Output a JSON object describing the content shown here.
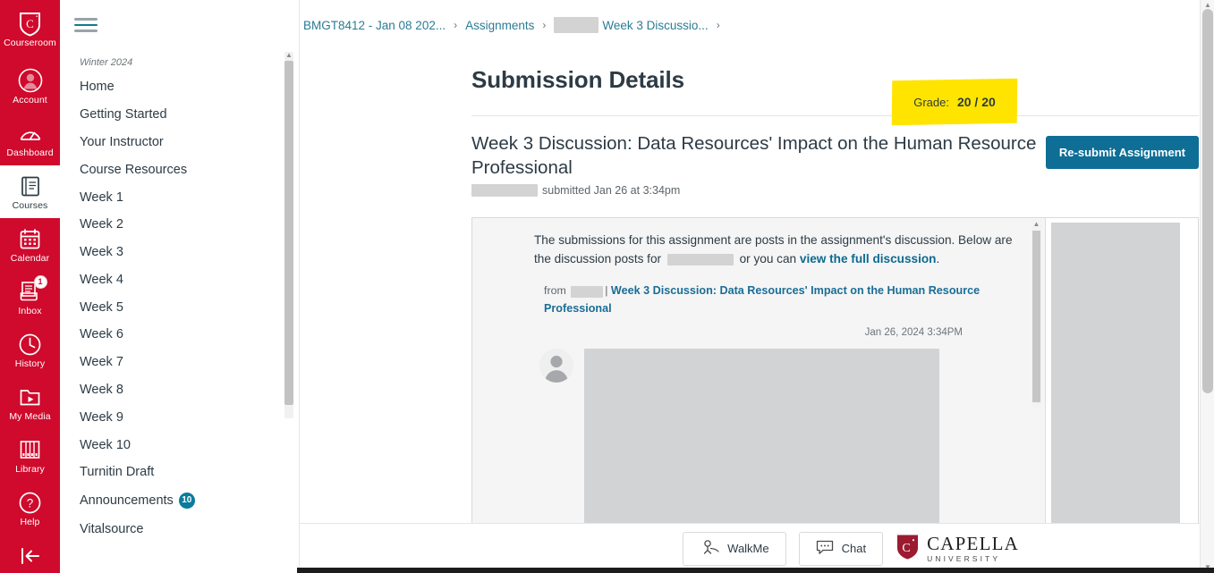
{
  "global_nav": {
    "items": [
      {
        "label": "Courseroom",
        "icon": "capella-shield-icon",
        "active": false
      },
      {
        "label": "Account",
        "icon": "user-avatar-icon",
        "active": false
      },
      {
        "label": "Dashboard",
        "icon": "speedometer-icon",
        "active": false
      },
      {
        "label": "Courses",
        "icon": "book-icon",
        "active": true
      },
      {
        "label": "Calendar",
        "icon": "calendar-icon",
        "active": false
      },
      {
        "label": "Inbox",
        "icon": "inbox-tray-icon",
        "active": false,
        "badge": "1"
      },
      {
        "label": "History",
        "icon": "clock-icon",
        "active": false
      },
      {
        "label": "My Media",
        "icon": "media-folder-icon",
        "active": false
      },
      {
        "label": "Library",
        "icon": "library-books-icon",
        "active": false
      },
      {
        "label": "Help",
        "icon": "question-circle-icon",
        "active": false
      }
    ],
    "collapse_label": "collapse-nav-icon"
  },
  "course_nav": {
    "term": "Winter 2024",
    "items": [
      {
        "label": "Home"
      },
      {
        "label": "Getting Started"
      },
      {
        "label": "Your Instructor"
      },
      {
        "label": "Course Resources"
      },
      {
        "label": "Week 1"
      },
      {
        "label": "Week 2"
      },
      {
        "label": "Week 3"
      },
      {
        "label": "Week 4"
      },
      {
        "label": "Week 5"
      },
      {
        "label": "Week 6"
      },
      {
        "label": "Week 7"
      },
      {
        "label": "Week 8"
      },
      {
        "label": "Week 9"
      },
      {
        "label": "Week 10"
      },
      {
        "label": "Turnitin Draft"
      },
      {
        "label": "Announcements",
        "badge": "10"
      },
      {
        "label": "Vitalsource"
      }
    ]
  },
  "breadcrumb": {
    "items": [
      {
        "label": "BMGT8412 - Jan 08 202...",
        "redacted": false
      },
      {
        "label": "Assignments",
        "redacted": false
      },
      {
        "label": "Week 3 Discussio...",
        "redacted": true
      }
    ],
    "separator": "›"
  },
  "page": {
    "title": "Submission Details",
    "grade_label": "Grade:",
    "grade_value": "20 / 20",
    "grade_highlight_color": "#FFE400"
  },
  "assignment": {
    "title": "Week 3 Discussion: Data Resources' Impact on the Human Resource Professional",
    "submitted_text": "submitted Jan 26 at 3:34pm",
    "resubmit_button": "Re-submit Assignment",
    "resubmit_color": "#0E6E96"
  },
  "submission": {
    "intro_part1": "The submissions for this assignment are posts in the assignment's discussion. Below are the discussion posts for",
    "intro_part2": "or you can",
    "intro_link": "view the full discussion",
    "intro_end": ".",
    "post_from_label": "from",
    "post_separator": "|",
    "post_title": "Week 3 Discussion: Data Resources' Impact on the Human Resource Professional",
    "post_date": "Jan 26, 2024 3:34PM",
    "avatar": "default-user-avatar"
  },
  "footer": {
    "walkme_label": "WalkMe",
    "walkme_icon": "walkme-icon",
    "chat_label": "Chat",
    "chat_icon": "chat-bubble-icon",
    "logo_name": "CAPELLA",
    "logo_sub": "UNIVERSITY"
  }
}
